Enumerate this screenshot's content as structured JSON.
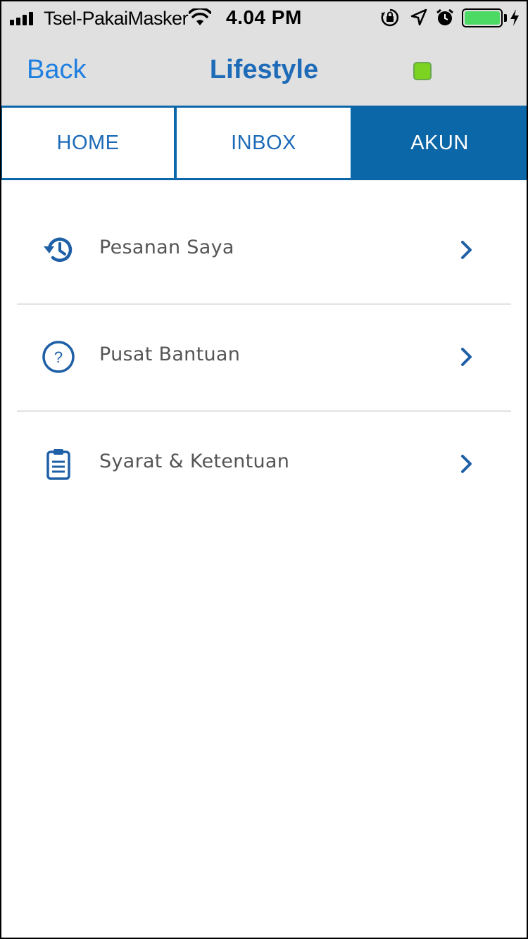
{
  "status_bar": {
    "carrier": "Tsel-PakaiMasker",
    "time": "4.04 PM",
    "icons": [
      "signal-icon",
      "wifi-icon",
      "orientation-lock-icon",
      "location-icon",
      "alarm-icon",
      "battery-icon",
      "charging-icon"
    ],
    "battery_color": "#4cd964"
  },
  "nav": {
    "back_label": "Back",
    "title": "Lifestyle",
    "status_indicator_color": "#7cd321"
  },
  "tabs": [
    {
      "label": "HOME",
      "active": false
    },
    {
      "label": "INBOX",
      "active": false
    },
    {
      "label": "AKUN",
      "active": true
    }
  ],
  "menu": {
    "items": [
      {
        "label": "Pesanan Saya",
        "icon": "history-icon"
      },
      {
        "label": "Pusat Bantuan",
        "icon": "help-circle-icon"
      },
      {
        "label": "Syarat & Ketentuan",
        "icon": "clipboard-icon"
      }
    ]
  },
  "colors": {
    "accent": "#0c67a8",
    "nav_title": "#1e6bb8",
    "back_link": "#1e7fe0",
    "header_bg": "#e0e0e0"
  }
}
